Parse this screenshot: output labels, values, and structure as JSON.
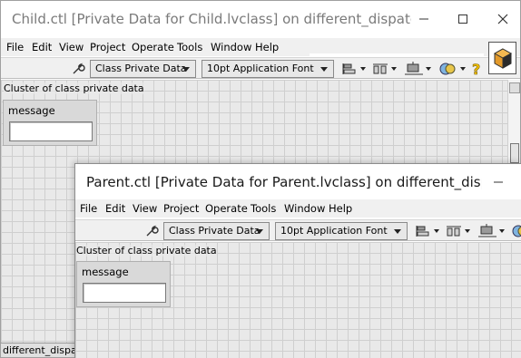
{
  "child_window": {
    "title": "Child.ctl [Private Data for Child.lvclass] on different_dispatches.lv…",
    "menu": [
      "File",
      "Edit",
      "View",
      "Project",
      "Operate",
      "Tools",
      "Window",
      "Help"
    ],
    "toolbar": {
      "class_dropdown": "Class Private Data",
      "font_dropdown": "10pt Application Font"
    },
    "panel_label": "Cluster of class private data",
    "control_label": "message",
    "status_text": "different_dispat"
  },
  "parent_window": {
    "title": "Parent.ctl [Private Data for Parent.lvclass] on different_dispatche…",
    "menu": [
      "File",
      "Edit",
      "View",
      "Project",
      "Operate",
      "Tools",
      "Window",
      "Help"
    ],
    "toolbar": {
      "class_dropdown": "Class Private Data",
      "font_dropdown": "10pt Application Font"
    },
    "panel_label": "Cluster of class private data",
    "control_label": "message"
  },
  "colors": {
    "grid_background": "#e9e9e9",
    "grid_lines": "#cfcfcf",
    "toolbar_background": "#f0f0f0",
    "cluster_fill": "#d9d9d9",
    "help_icon": "#f2c200"
  },
  "icons": {
    "wrench": "wrench-icon",
    "align": "align-objects-icon",
    "distribute": "distribute-objects-icon",
    "resize": "resize-objects-icon",
    "reorder": "reorder-icon",
    "help": "help-icon",
    "vi": "vi-icon"
  }
}
